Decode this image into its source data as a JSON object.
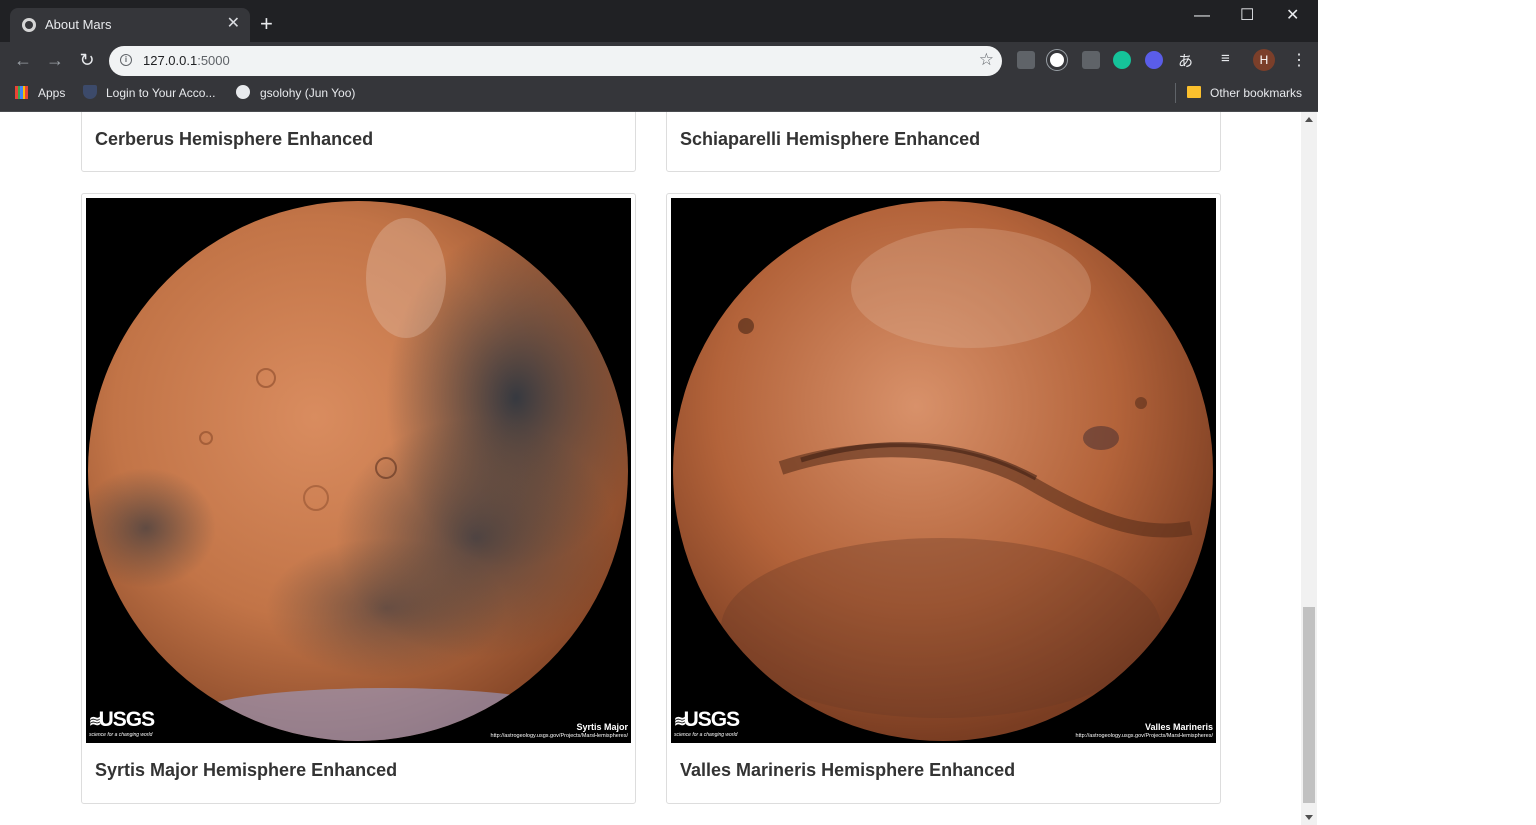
{
  "browser": {
    "tab_title": "About Mars",
    "tab_close": "✕",
    "new_tab": "+",
    "url_host": "127.0.0.1",
    "url_port": ":5000",
    "avatar_letter": "H",
    "extension_ja": "あ",
    "window_controls": {
      "minimize": "—",
      "maximize": "☐",
      "close": "✕"
    }
  },
  "bookmarks": {
    "items": [
      {
        "label": "Apps"
      },
      {
        "label": "Login to Your Acco..."
      },
      {
        "label": "gsolohy (Jun Yoo)"
      }
    ],
    "other": "Other bookmarks"
  },
  "hemispheres": [
    {
      "title": "Cerberus Hemisphere Enhanced"
    },
    {
      "title": "Schiaparelli Hemisphere Enhanced"
    },
    {
      "title": "Syrtis Major Hemisphere Enhanced",
      "image_label": "Syrtis Major",
      "image_url_text": "http://astrogeology.usgs.gov/Projects/MarsHemispheres/"
    },
    {
      "title": "Valles Marineris Hemisphere Enhanced",
      "image_label": "Valles Marineris",
      "image_url_text": "http://astrogeology.usgs.gov/Projects/MarsHemispheres/"
    }
  ],
  "usgs": {
    "logo": "USGS",
    "tagline": "science for a changing world"
  },
  "colors": {
    "chrome_dark": "#202124",
    "toolbar": "#35363a",
    "caption_text": "#333333",
    "card_border": "#dddddd",
    "mars_light": "#d98c5f",
    "mars_mid": "#b3633a",
    "mars_dark_region": "#2f3640"
  }
}
